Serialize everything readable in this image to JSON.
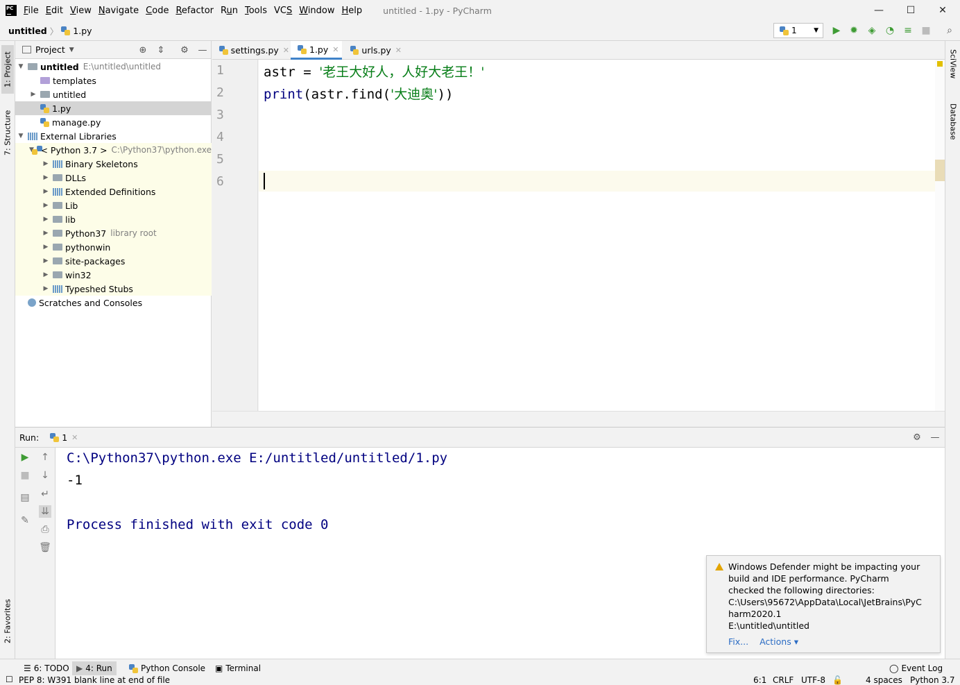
{
  "window": {
    "logo": "PC",
    "title": "untitled - 1.py - PyCharm",
    "menu": [
      {
        "pre": "",
        "u": "F",
        "post": "ile"
      },
      {
        "pre": "",
        "u": "E",
        "post": "dit"
      },
      {
        "pre": "",
        "u": "V",
        "post": "iew"
      },
      {
        "pre": "",
        "u": "N",
        "post": "avigate"
      },
      {
        "pre": "",
        "u": "C",
        "post": "ode"
      },
      {
        "pre": "",
        "u": "R",
        "post": "efactor"
      },
      {
        "pre": "R",
        "u": "u",
        "post": "n"
      },
      {
        "pre": "",
        "u": "T",
        "post": "ools"
      },
      {
        "pre": "VC",
        "u": "S",
        "post": ""
      },
      {
        "pre": "",
        "u": "W",
        "post": "indow"
      },
      {
        "pre": "",
        "u": "H",
        "post": "elp"
      }
    ],
    "controls": {
      "minimize": "—",
      "maximize": "☐",
      "close": "✕"
    }
  },
  "navbar": {
    "project": "untitled",
    "separator": "〉",
    "file": "1.py",
    "run_config": "1"
  },
  "left_stripe": {
    "project_tab": "1: Project",
    "structure_tab": "7: Structure",
    "favorites_tab": "2: Favorites"
  },
  "right_stripe": {
    "sciview_tab": "SciView",
    "database_tab": "Database"
  },
  "project_panel": {
    "title": "Project",
    "tree": [
      {
        "label": "untitled",
        "hint": "E:\\untitled\\untitled"
      },
      {
        "label": "templates"
      },
      {
        "label": "untitled"
      },
      {
        "label": "1.py"
      },
      {
        "label": "manage.py"
      },
      {
        "label": "External Libraries"
      },
      {
        "label": "< Python 3.7 >",
        "hint": "C:\\Python37\\python.exe"
      },
      {
        "label": "Binary Skeletons"
      },
      {
        "label": "DLLs"
      },
      {
        "label": "Extended Definitions"
      },
      {
        "label": "Lib"
      },
      {
        "label": "lib"
      },
      {
        "label": "Python37",
        "hint": "library root"
      },
      {
        "label": "pythonwin"
      },
      {
        "label": "site-packages"
      },
      {
        "label": "win32"
      },
      {
        "label": "Typeshed Stubs"
      },
      {
        "label": "Scratches and Consoles"
      }
    ]
  },
  "editor": {
    "tabs": [
      {
        "label": "settings.py"
      },
      {
        "label": "1.py"
      },
      {
        "label": "urls.py"
      }
    ],
    "line_numbers": [
      "1",
      "2",
      "3",
      "4",
      "5",
      "6"
    ],
    "code": {
      "l1_var": "astr = ",
      "l1_str": "'老王大好人，人好大老王！'",
      "l2_fn": "print",
      "l2_mid": "(astr.find(",
      "l2_str": "'大迪奥'",
      "l2_end": "))"
    }
  },
  "run_panel": {
    "label": "Run:",
    "tab": "1",
    "output": [
      "C:\\Python37\\python.exe E:/untitled/untitled/1.py",
      "-1",
      "",
      "Process finished with exit code 0"
    ]
  },
  "notification": {
    "lines": [
      "Windows Defender might be impacting your",
      "build and IDE performance. PyCharm",
      "checked the following directories:",
      "C:\\Users\\95672\\AppData\\Local\\JetBrains\\PyC",
      "harm2020.1",
      "E:\\untitled\\untitled"
    ],
    "fix": "Fix...",
    "actions": "Actions ▾"
  },
  "tool_windows": {
    "todo": "6: TODO",
    "run": "4: Run",
    "python_console": "Python Console",
    "terminal": "Terminal",
    "event_log": "Event Log"
  },
  "status": {
    "message": "PEP 8: W391 blank line at end of file",
    "position": "6:1",
    "line_sep": "CRLF",
    "encoding": "UTF-8",
    "indent": "4 spaces",
    "interpreter": "Python 3.7"
  },
  "colors": {
    "accent": "#4083c9",
    "run_green": "#3f9c35",
    "string": "#067d17",
    "keyword_blue": "#000080"
  }
}
